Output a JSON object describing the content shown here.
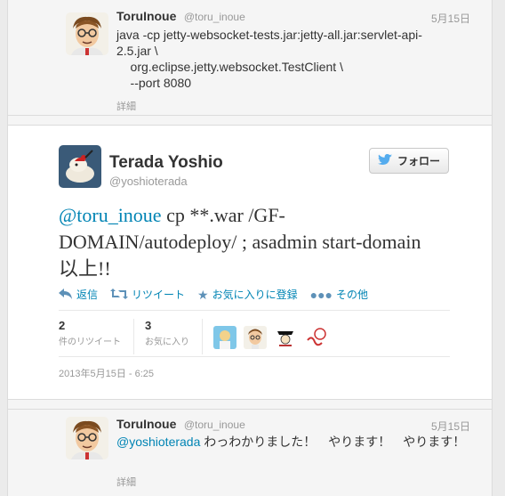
{
  "top_reply": {
    "name": "ToruInoue",
    "handle": "@toru_inoue",
    "date": "5月15日",
    "text": "java -cp jetty-websocket-tests.jar:jetty-all.jar:servlet-api-\n2.5.jar \\\n    org.eclipse.jetty.websocket.TestClient \\\n    --port 8080",
    "detail": "詳細"
  },
  "main_tweet": {
    "name": "Terada Yoshio",
    "handle": "@yoshioterada",
    "follow_label": "フォロー",
    "mention": "@toru_inoue",
    "body": " cp **.war /GF-DOMAIN/autodeploy/ ; asadmin start-domain 以上!!",
    "actions": {
      "reply": "返信",
      "retweet": "リツイート",
      "favorite": "お気に入りに登録",
      "more": "その他"
    },
    "stats": {
      "retweets_count": "2",
      "retweets_label": "件のリツイート",
      "favorites_count": "3",
      "favorites_label": "お気に入り"
    },
    "timestamp": "2013年5月15日 - 6:25"
  },
  "bottom_reply": {
    "name": "ToruInoue",
    "handle": "@toru_inoue",
    "date": "5月15日",
    "mention": "@yoshioterada",
    "text": " わっわかりました！　やります！　やります！",
    "detail": "詳細"
  },
  "colors": {
    "link": "#0084b4",
    "twitter_blue": "#55acee"
  }
}
